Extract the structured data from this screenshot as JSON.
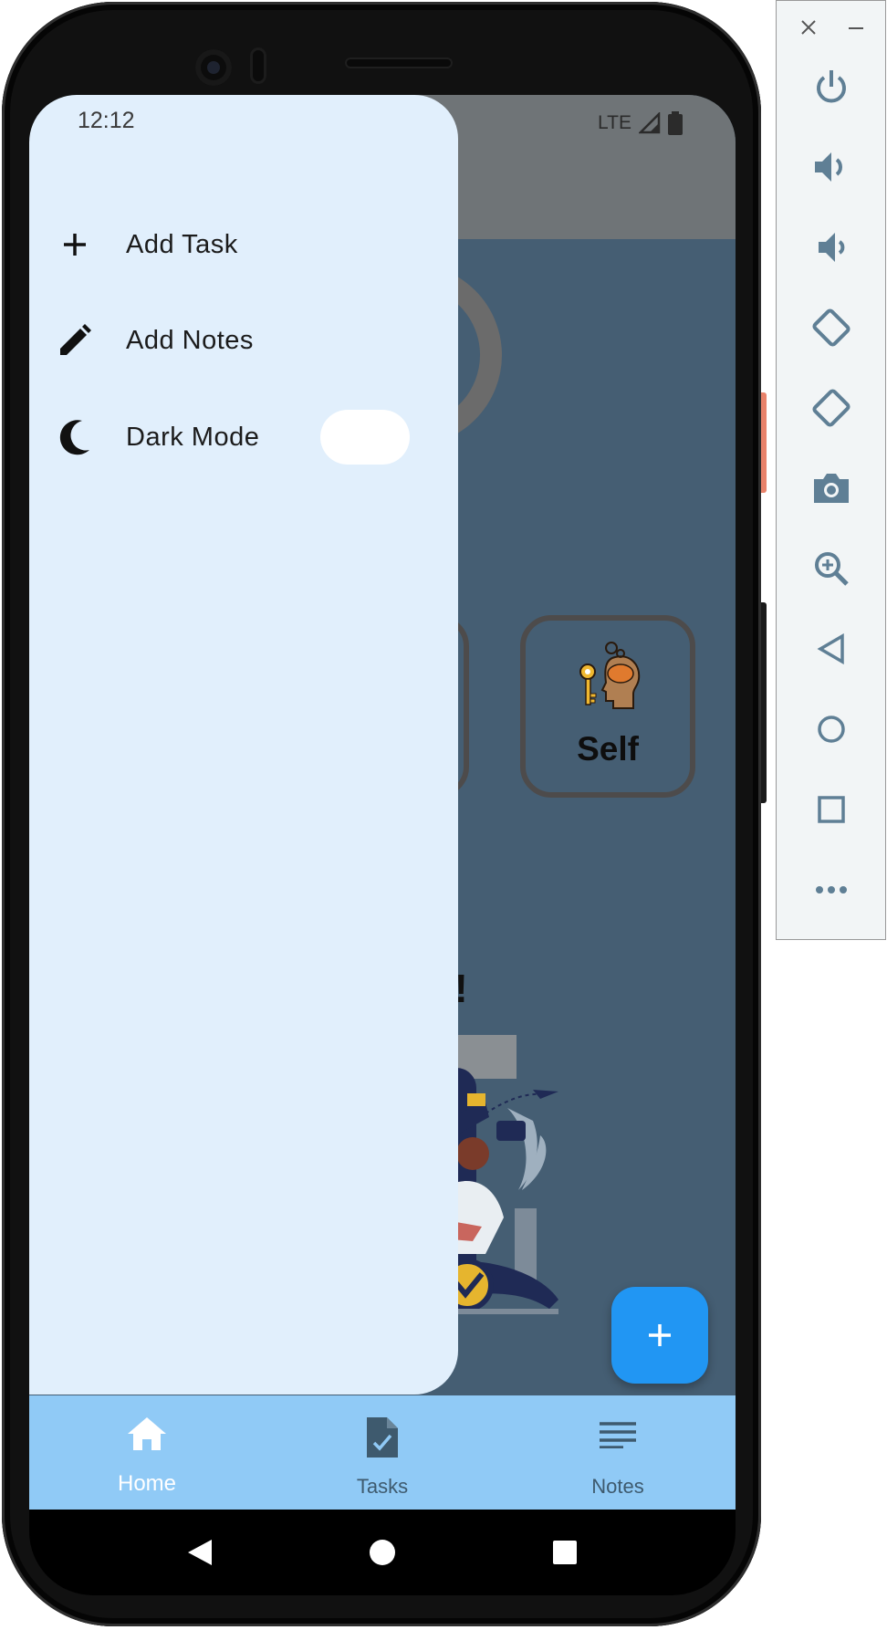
{
  "status_bar": {
    "time": "12:12",
    "network": "LTE"
  },
  "home": {
    "cards": [
      {
        "label": "Self"
      }
    ],
    "heading_fragment": "!"
  },
  "drawer": {
    "items": [
      {
        "label": "Add Task",
        "icon": "plus-icon"
      },
      {
        "label": "Add Notes",
        "icon": "pencil-icon"
      },
      {
        "label": "Dark Mode",
        "icon": "moon-icon",
        "toggle_on": false
      }
    ]
  },
  "fab": {
    "label": "+"
  },
  "bottom_nav": {
    "items": [
      {
        "label": "Home",
        "icon": "home-icon",
        "selected": true
      },
      {
        "label": "Tasks",
        "icon": "task-document-icon",
        "selected": false
      },
      {
        "label": "Notes",
        "icon": "notes-lines-icon",
        "selected": false
      }
    ]
  },
  "emulator_panel": {
    "window_controls": [
      "close-icon",
      "minimize-icon"
    ],
    "buttons": [
      "power-icon",
      "volume-up-icon",
      "volume-down-icon",
      "rotate-left-icon",
      "rotate-right-icon",
      "camera-icon",
      "zoom-icon",
      "back-icon",
      "home-icon",
      "overview-icon",
      "more-icon"
    ]
  },
  "colors": {
    "drawer_bg": "#e1effc",
    "bottom_nav_bg": "#90caf6",
    "fab_bg": "#2196f3",
    "scrim_bg": "#455e73"
  }
}
